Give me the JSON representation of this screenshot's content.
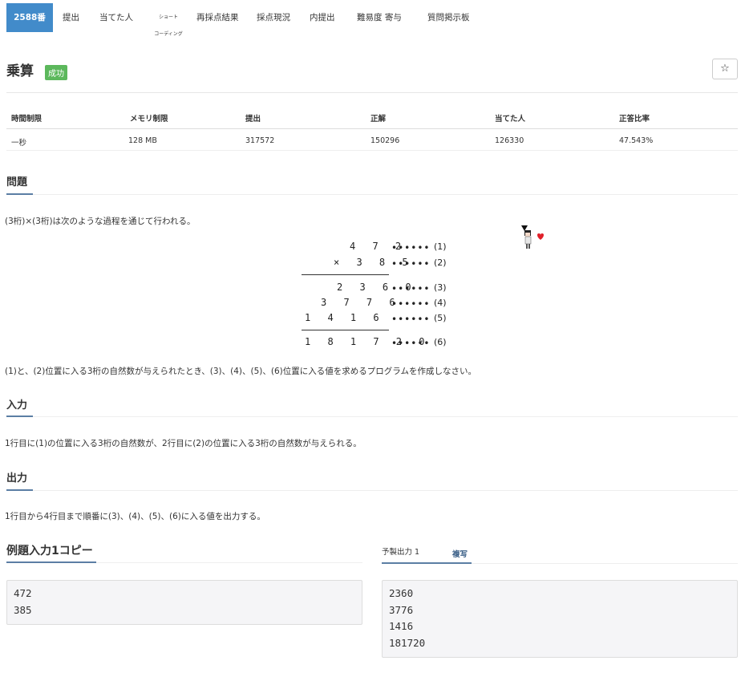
{
  "tabs": {
    "problem_no": "2588番",
    "submit": "提出",
    "solved_by": "当てた人",
    "short_coding_top": "ショート",
    "short_coding_bottom": "コーディング",
    "rejudge": "再採点結果",
    "status": "採点現況",
    "my_submissions": "内提出",
    "difficulty": "難易度 寄与",
    "board": "質問掲示板"
  },
  "problem": {
    "title": "乗算",
    "badge": "成功",
    "star_icon": "☆"
  },
  "info_table": {
    "headers": [
      "時間制限",
      "メモリ制限",
      "提出",
      "正解",
      "当てた人",
      "正答比率"
    ],
    "values": [
      "一秒",
      "128 MB",
      "317572",
      "150296",
      "126330",
      "47.543%"
    ]
  },
  "sections": {
    "problem": "問題",
    "input": "入力",
    "output": "出力"
  },
  "statement": {
    "intro": "(3桁)×(3桁)は次のような過程を通じて行われる。",
    "task": "(1)と、(2)位置に入る3桁の自然数が与えられたとき、(3)、(4)、(5)、(6)位置に入る値を求めるプログラムを作成しなさい。",
    "input_desc": "1行目に(1)の位置に入る3桁の自然数が、2行目に(2)の位置に入る3桁の自然数が与えられる。",
    "output_desc": "1行目から4行目まで順番に(3)、(4)、(5)、(6)に入る値を出力する。"
  },
  "calc": {
    "rows": [
      {
        "digits": "4 7 2",
        "dots": "••••••",
        "label": "(1)"
      },
      {
        "digits": "× 3 8 5",
        "dots": "••••••",
        "label": "(2)"
      },
      {
        "digits": "2 3 6 0",
        "dots": "••••••",
        "label": "(3)"
      },
      {
        "digits": "3 7 7 6",
        "dots": "••••••",
        "label": "(4)"
      },
      {
        "digits": "1 4 1 6",
        "dots": "••••••",
        "label": "(5)"
      },
      {
        "digits": "1 8 1 7 2 0",
        "dots": "••••••",
        "label": "(6)"
      }
    ]
  },
  "sample": {
    "input_title": "例題入力1コピー",
    "output_title": "予製出力 1",
    "copy_label": "複写",
    "input_lines": [
      "472",
      "385"
    ],
    "output_lines": [
      "2360",
      "3776",
      "1416",
      "181720"
    ]
  }
}
